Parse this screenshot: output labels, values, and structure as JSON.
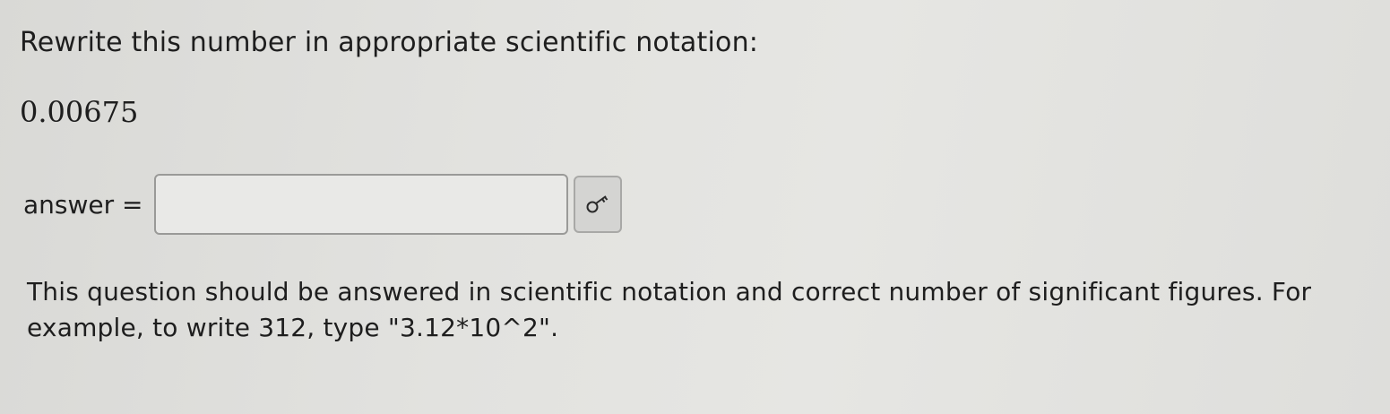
{
  "question": {
    "prompt": "Rewrite this number in appropriate scientific notation:",
    "number": "0.00675",
    "answer_label": "answer =",
    "answer_value": "",
    "key_button_icon": "key-icon",
    "instruction": "This question should be answered in scientific notation and correct number of significant figures. For example, to write 312, type \"3.12*10^2\"."
  }
}
